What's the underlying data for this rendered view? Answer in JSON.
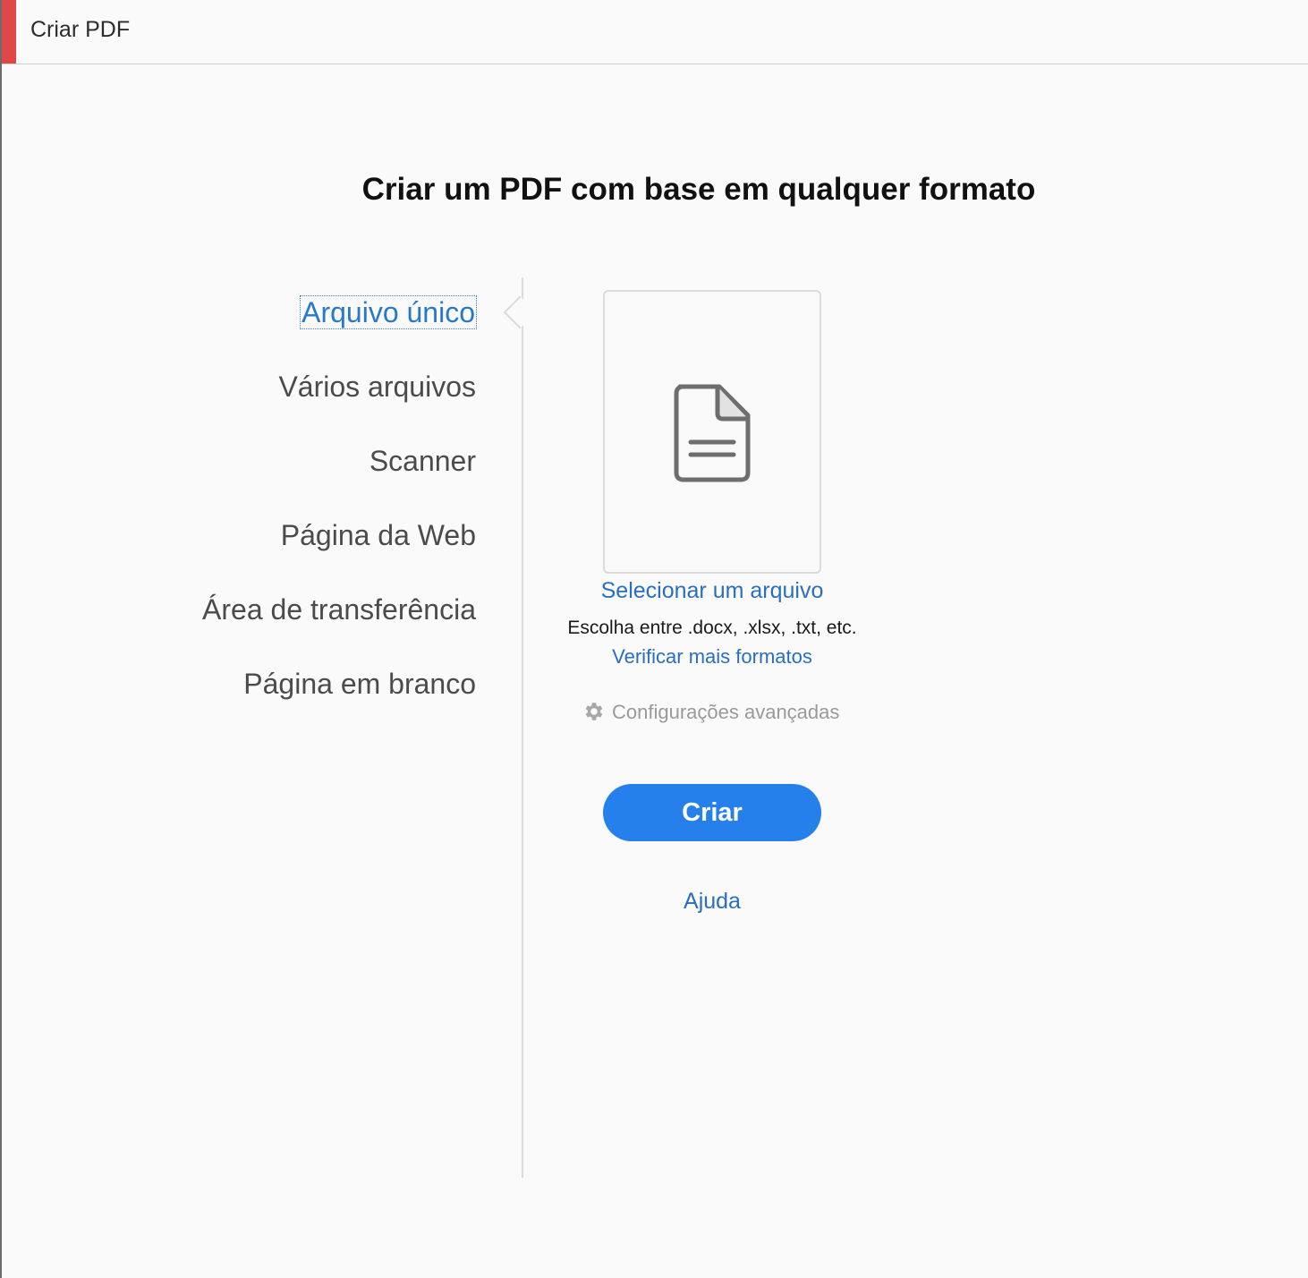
{
  "window": {
    "title": "Criar PDF",
    "accent_color": "#e04848"
  },
  "main": {
    "heading": "Criar um PDF com base em qualquer formato"
  },
  "nav": {
    "active_index": 0,
    "items": [
      {
        "label": "Arquivo único"
      },
      {
        "label": "Vários arquivos"
      },
      {
        "label": "Scanner"
      },
      {
        "label": "Página da Web"
      },
      {
        "label": "Área de transferência"
      },
      {
        "label": "Página em branco"
      }
    ]
  },
  "file_panel": {
    "icon": "document-icon",
    "select_label": "Selecionar um arquivo",
    "hint": "Escolha entre .docx, .xlsx, .txt, etc.",
    "more_formats_label": "Verificar mais formatos",
    "advanced_label": "Configurações avançadas",
    "advanced_icon": "gear-icon"
  },
  "actions": {
    "create_label": "Criar",
    "help_label": "Ajuda",
    "primary_color": "#2680eb",
    "link_color": "#2a6fbf"
  }
}
